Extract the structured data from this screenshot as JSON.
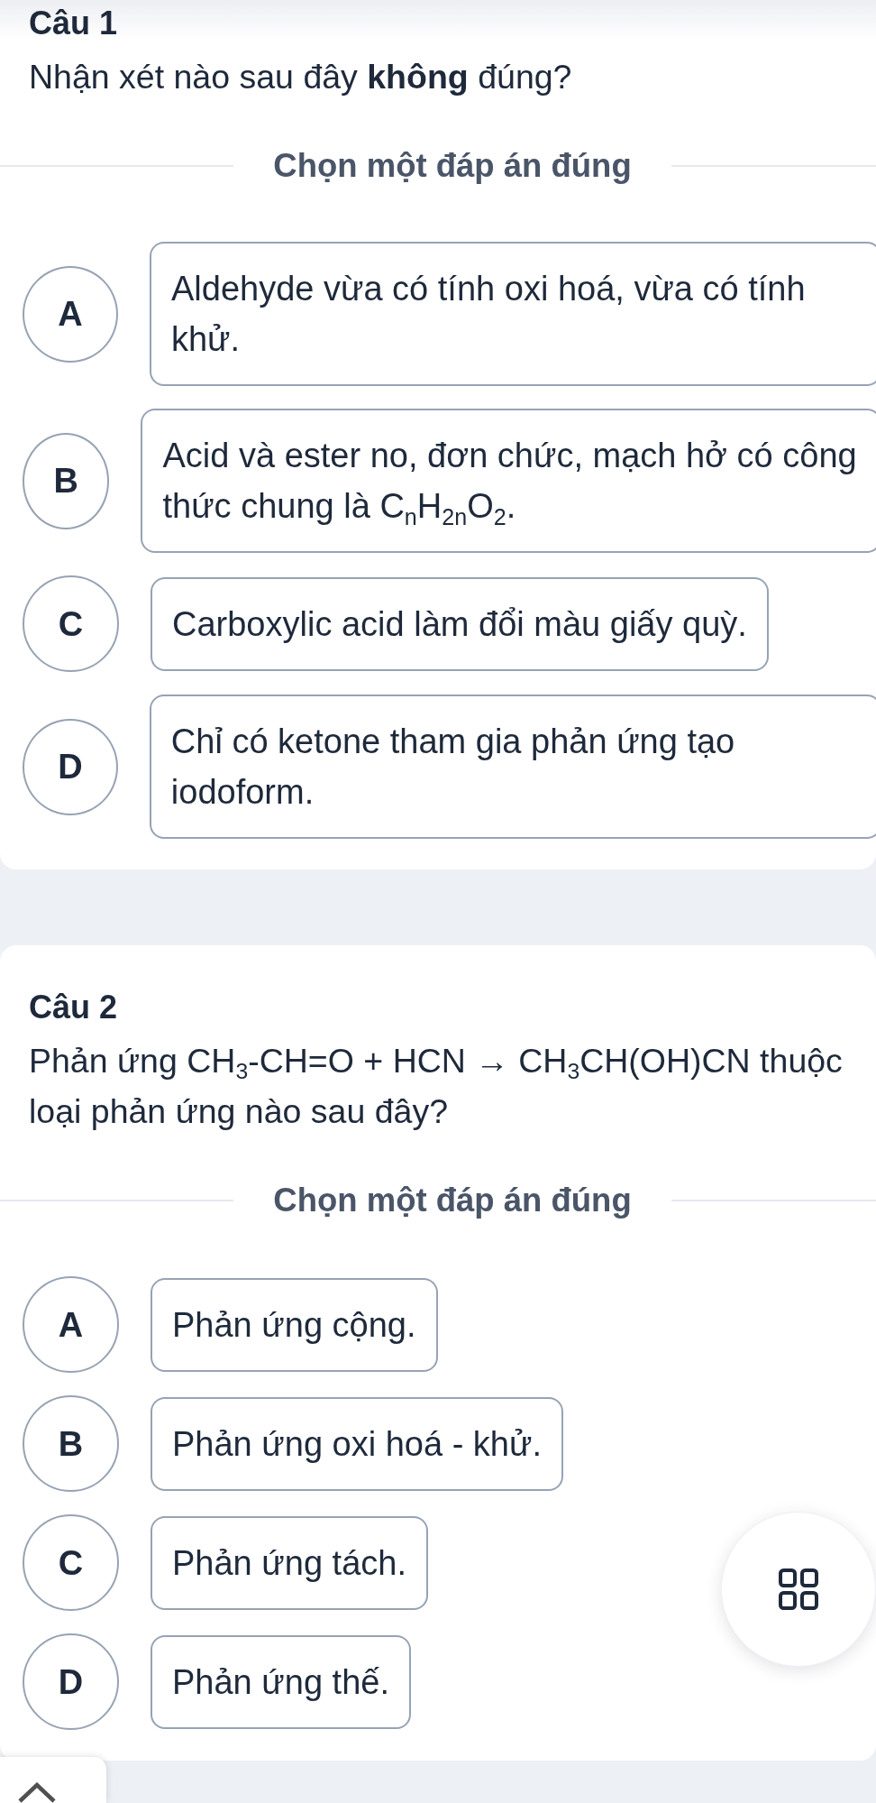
{
  "questions": [
    {
      "title": "Câu 1",
      "prompt": "Nhận xét nào sau đây **không** đúng?",
      "instruction": "Chọn một đáp án đúng",
      "options": [
        {
          "letter": "A",
          "text": "Aldehyde vừa có tính oxi hoá, vừa có tính khử.",
          "selected": false
        },
        {
          "letter": "B",
          "text": "Acid và ester no, đơn chức, mạch hở có công thức chung là C$_{n}$H$_{2n}$O$_{2}$.",
          "selected": false
        },
        {
          "letter": "C",
          "text": "Carboxylic acid làm đổi màu giấy quỳ.",
          "selected": false
        },
        {
          "letter": "D",
          "text": "Chỉ có ketone tham gia phản ứng tạo iodoform.",
          "selected": false
        }
      ]
    },
    {
      "title": "Câu 2",
      "prompt": "Phản ứng CH$_{3}$-CH=O + HCN → CH$_{3}$CH(OH)CN thuộc loại phản ứng nào sau đây?",
      "instruction": "Chọn một đáp án đúng",
      "options": [
        {
          "letter": "A",
          "text": "Phản ứng cộng.",
          "selected": false
        },
        {
          "letter": "B",
          "text": "Phản ứng oxi hoá - khử.",
          "selected": false
        },
        {
          "letter": "C",
          "text": "Phản ứng tách.",
          "selected": false
        },
        {
          "letter": "D",
          "text": "Phản ứng thế.",
          "selected": false
        }
      ]
    }
  ]
}
